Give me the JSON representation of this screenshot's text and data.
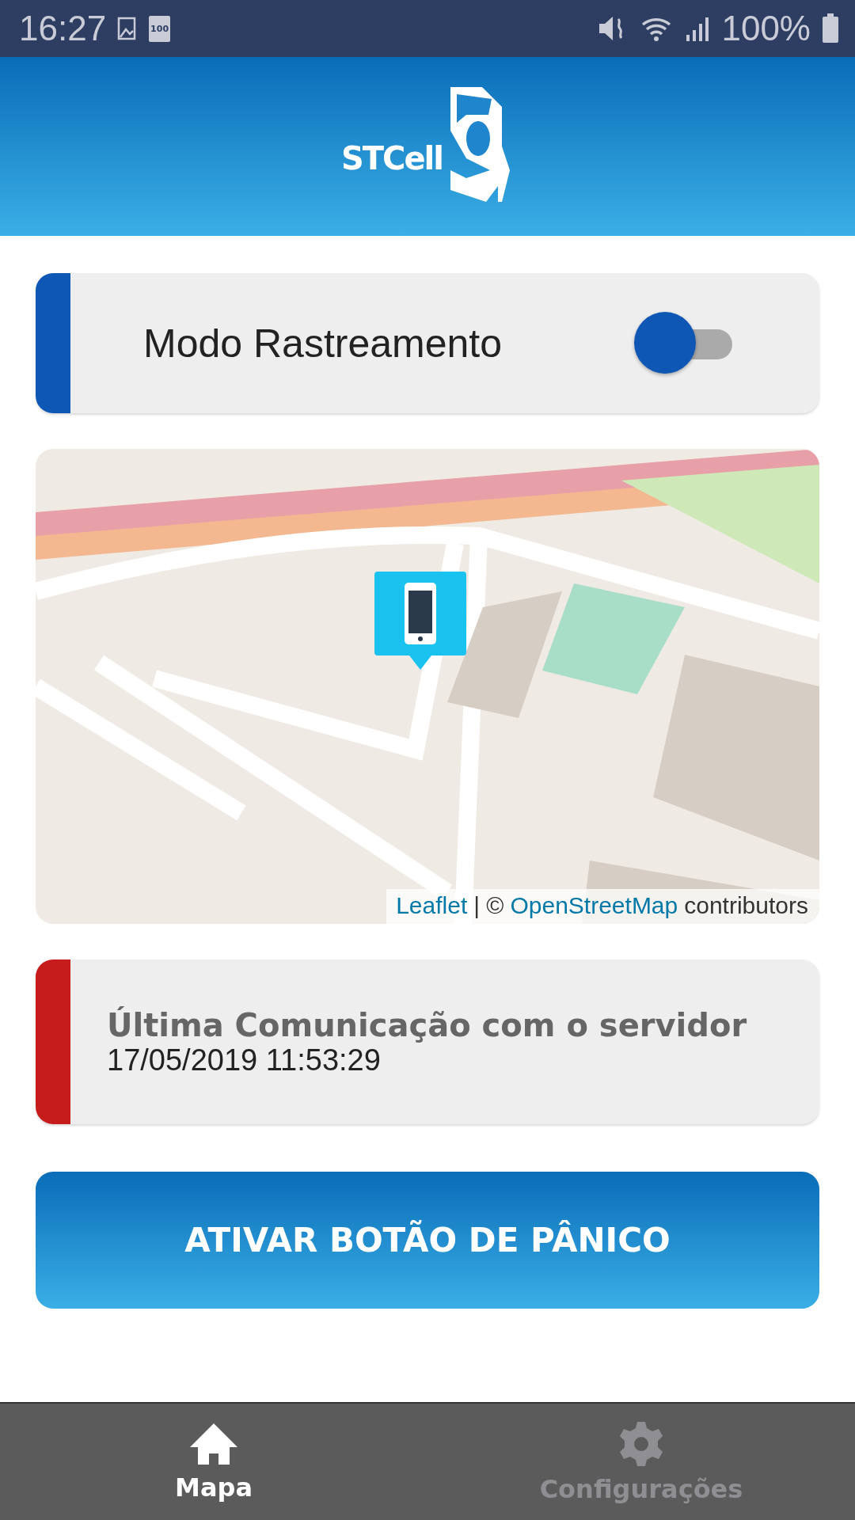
{
  "status_bar": {
    "time": "16:27",
    "battery_icon_text": "100",
    "battery": "100%"
  },
  "header": {
    "logo": "STCell"
  },
  "tracking": {
    "label": "Modo Rastreamento",
    "on": false
  },
  "map": {
    "kind": "picture",
    "attribution": {
      "link_1": "Leaflet",
      "separator": "| ©",
      "link_2": "OpenStreetMap",
      "suffix": "contributors"
    }
  },
  "last_communication": {
    "title": "Última Comunicação com o servidor",
    "value": "17/05/2019 11:53:29"
  },
  "panic_button": "ATIVAR BOTÃO DE PÂNICO",
  "nav": [
    {
      "label": "Mapa",
      "kind": "home",
      "selected": true
    },
    {
      "label": "Configurações",
      "kind": "settings",
      "selected": false
    }
  ]
}
